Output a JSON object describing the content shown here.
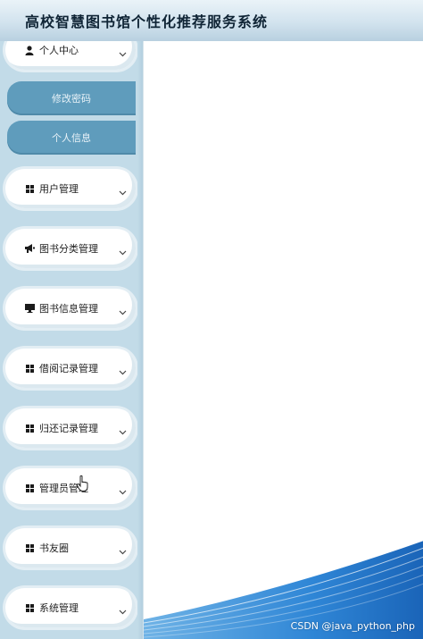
{
  "header": {
    "title": "高校智慧图书馆个性化推荐服务系统"
  },
  "sidebar": {
    "items": [
      {
        "label": "个人中心",
        "icon": "user-icon",
        "expanded": true
      },
      {
        "label": "用户管理",
        "icon": "grid-icon"
      },
      {
        "label": "图书分类管理",
        "icon": "bullhorn-icon"
      },
      {
        "label": "图书信息管理",
        "icon": "monitor-icon"
      },
      {
        "label": "借阅记录管理",
        "icon": "grid-icon"
      },
      {
        "label": "归还记录管理",
        "icon": "grid-icon"
      },
      {
        "label": "管理员管理",
        "icon": "grid-icon"
      },
      {
        "label": "书友圈",
        "icon": "grid-icon"
      },
      {
        "label": "系统管理",
        "icon": "grid-icon"
      }
    ],
    "subitems": [
      {
        "label": "修改密码"
      },
      {
        "label": "个人信息"
      }
    ]
  },
  "watermark": "CSDN @java_python_php",
  "colors": {
    "header_bg": "#d2e3ee",
    "sidebar_bg": "#c2dbe8",
    "submenu_bg": "#5f9cbc",
    "wave": "#2a7fd0"
  }
}
